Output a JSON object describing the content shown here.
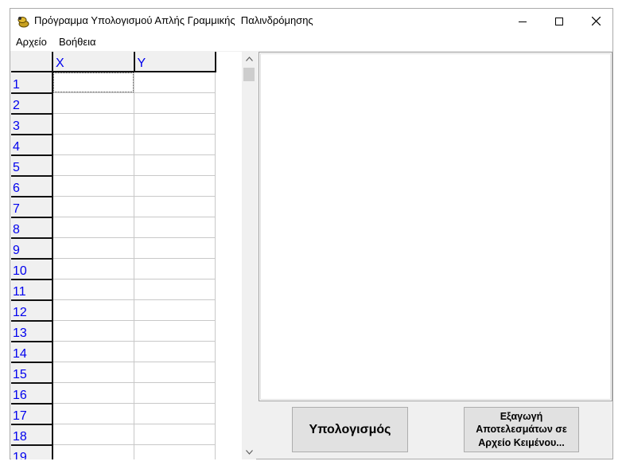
{
  "window": {
    "title": "Πρόγραμμα Υπολογισμού Απλής Γραμμικής  Παλινδρόμησης",
    "icon": "app-icon"
  },
  "menu": {
    "items": [
      "Αρχείο",
      "Βοήθεια"
    ]
  },
  "grid": {
    "columns": [
      "X",
      "Y"
    ],
    "rows": [
      "1",
      "2",
      "3",
      "4",
      "5",
      "6",
      "7",
      "8",
      "9",
      "10",
      "11",
      "12",
      "13",
      "14",
      "15",
      "16",
      "17",
      "18",
      "19"
    ]
  },
  "buttons": {
    "calculate": "Υπολογισμός",
    "export_line1": "Εξαγωγή",
    "export_line2": "Αποτελεσμάτων σε",
    "export_line3": "Αρχείο Κειμένου..."
  }
}
